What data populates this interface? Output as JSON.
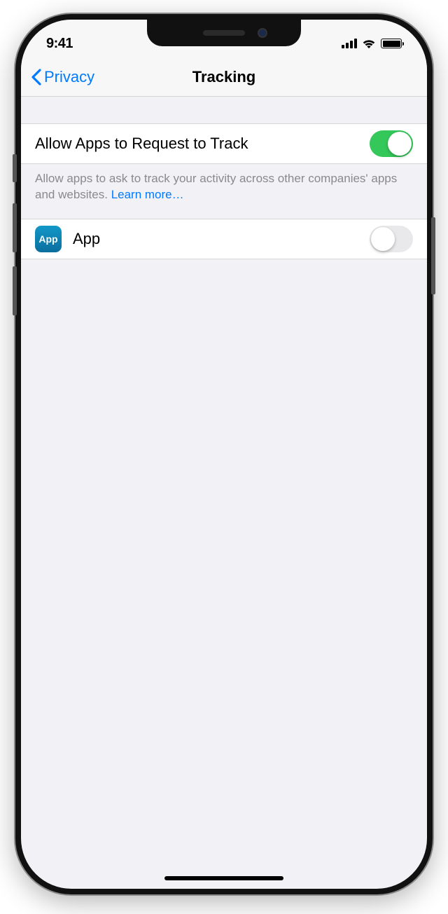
{
  "status": {
    "time": "9:41"
  },
  "nav": {
    "back_label": "Privacy",
    "title": "Tracking"
  },
  "settings": {
    "allow_request_label": "Allow Apps to Request to Track",
    "allow_request_on": true,
    "footer_text": "Allow apps to ask to track your activity across other companies' apps and websites. ",
    "footer_link": "Learn more…"
  },
  "apps": [
    {
      "name": "App",
      "icon_text": "App",
      "tracking_on": false
    }
  ]
}
